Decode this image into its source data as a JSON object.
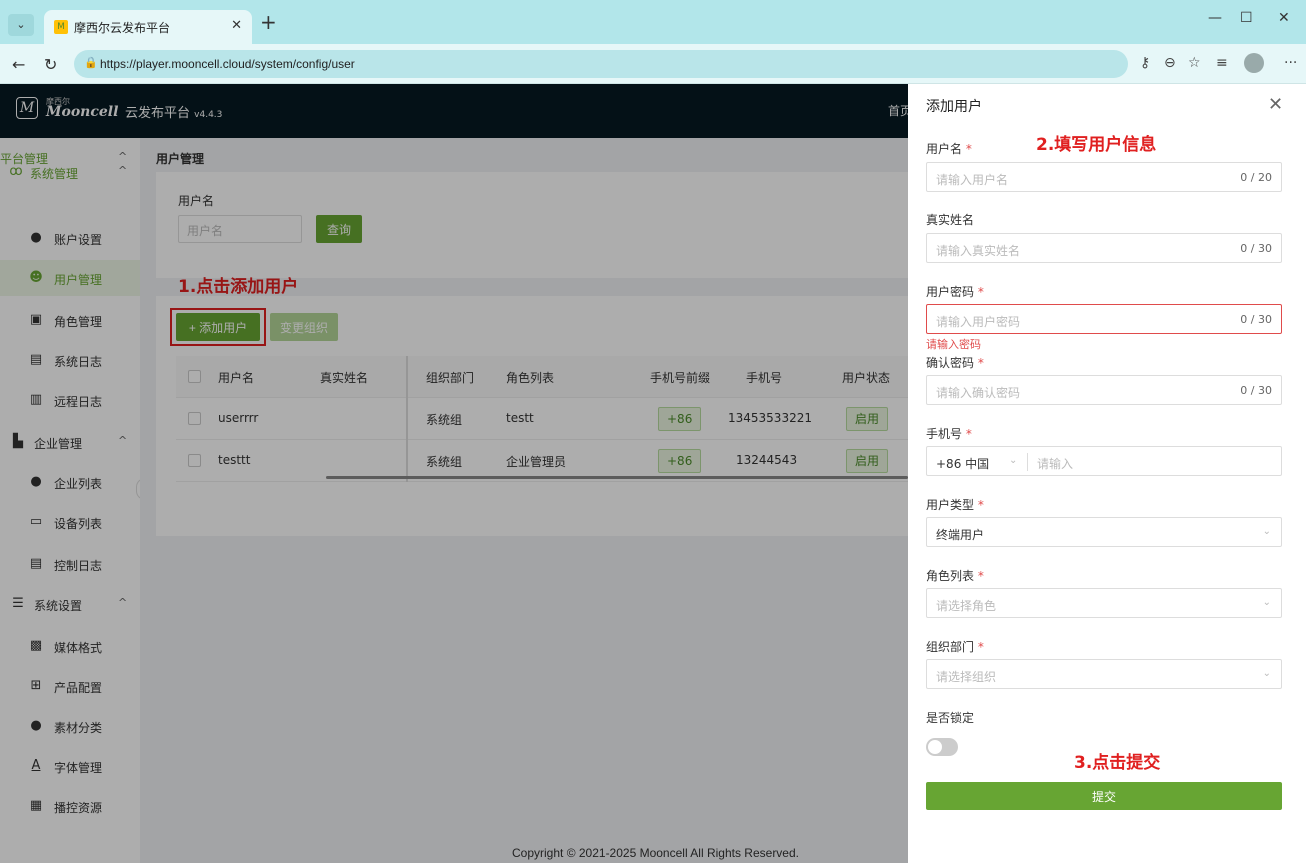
{
  "browser": {
    "tab_title": "摩西尔云发布平台",
    "url": "https://player.mooncell.cloud/system/config/user"
  },
  "app": {
    "logo_small": "摩西尔",
    "logo_name": "Mooncell",
    "title": "云发布平台",
    "version": "v4.4.3",
    "home": "首页"
  },
  "sidebar": {
    "head": "平台管理",
    "items": [
      {
        "label": "系统管理",
        "group": true
      },
      {
        "label": "账户设置"
      },
      {
        "label": "用户管理",
        "active": true
      },
      {
        "label": "角色管理"
      },
      {
        "label": "系统日志"
      },
      {
        "label": "远程日志"
      },
      {
        "label": "企业管理",
        "group": true
      },
      {
        "label": "企业列表"
      },
      {
        "label": "设备列表"
      },
      {
        "label": "控制日志"
      },
      {
        "label": "系统设置",
        "group": true
      },
      {
        "label": "媒体格式"
      },
      {
        "label": "产品配置"
      },
      {
        "label": "素材分类"
      },
      {
        "label": "字体管理"
      },
      {
        "label": "播控资源"
      }
    ]
  },
  "main": {
    "breadcrumb": "用户管理",
    "filter_label": "用户名",
    "filter_placeholder": "用户名",
    "query": "查询",
    "add_user": "+ 添加用户",
    "change_org": "变更组织",
    "columns": [
      "用户名",
      "真实姓名",
      "组织部门",
      "角色列表",
      "手机号前缀",
      "手机号",
      "用户状态"
    ],
    "rows": [
      {
        "username": "userrrr",
        "realname": "",
        "org": "系统组",
        "role": "testt",
        "prefix": "+86",
        "phone": "13453533221",
        "status": "启用"
      },
      {
        "username": "testtt",
        "realname": "",
        "org": "系统组",
        "role": "企业管理员",
        "prefix": "+86",
        "phone": "13244543",
        "status": "启用"
      }
    ],
    "footer": "Copyright © 2021-2025 Mooncell All Rights Reserved."
  },
  "annotations": {
    "step1": "1.点击添加用户",
    "step2": "2.填写用户信息",
    "step3": "3.点击提交"
  },
  "drawer": {
    "title": "添加用户",
    "username_label": "用户名",
    "username_ph": "请输入用户名",
    "username_count": "0 / 20",
    "realname_label": "真实姓名",
    "realname_ph": "请输入真实姓名",
    "realname_count": "0 / 30",
    "password_label": "用户密码",
    "password_ph": "请输入用户密码",
    "password_count": "0 / 30",
    "password_error": "请输入密码",
    "confirm_label": "确认密码",
    "confirm_ph": "请输入确认密码",
    "confirm_count": "0 / 30",
    "phone_label": "手机号",
    "phone_prefix": "+86 中国",
    "phone_ph": "请输入",
    "type_label": "用户类型",
    "type_value": "终端用户",
    "role_label": "角色列表",
    "role_ph": "请选择角色",
    "org_label": "组织部门",
    "org_ph": "请选择组织",
    "lock_label": "是否锁定",
    "lock_on": false,
    "submit": "提交"
  },
  "colors": {
    "accent": "#67a533",
    "danger": "#e02020",
    "topbar": "#071a22"
  }
}
